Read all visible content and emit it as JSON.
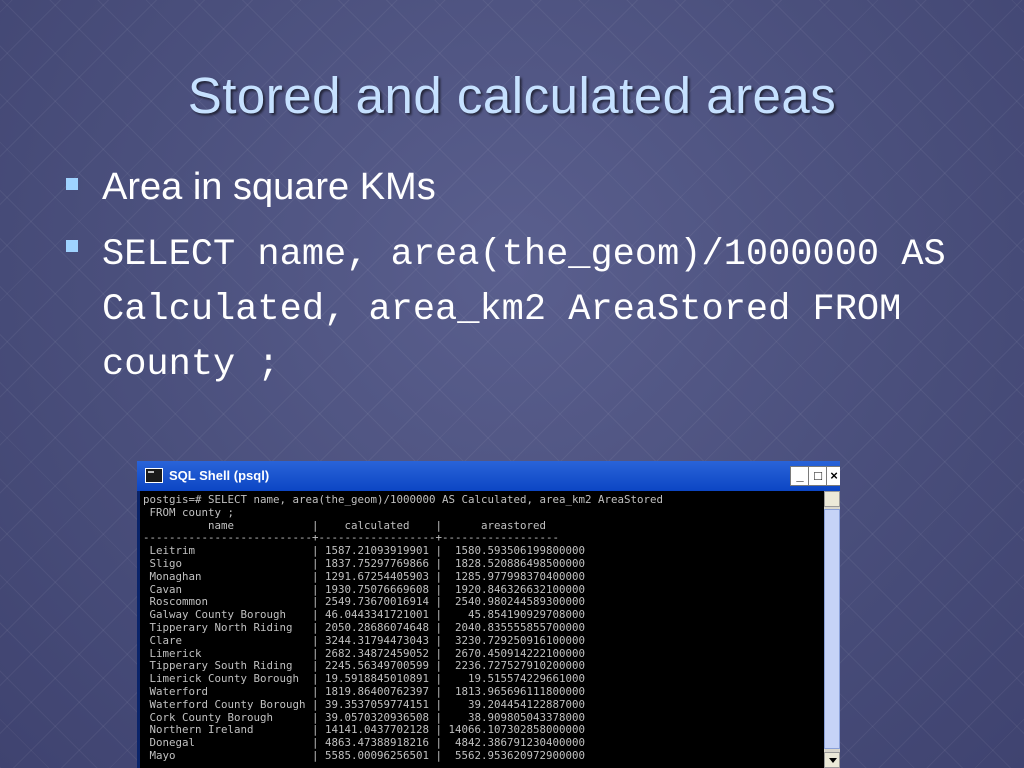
{
  "slide": {
    "title": "Stored and calculated areas",
    "bullets": [
      "Area in square KMs",
      "SELECT name, area(the_geom)/1000000 AS Calculated, area_km2 AreaStored FROM county ;"
    ]
  },
  "window": {
    "title": "SQL Shell (psql)",
    "min_label": "_",
    "max_label": "□",
    "close_label": "×",
    "console_lines": [
      "postgis=# SELECT name, area(the_geom)/1000000 AS Calculated, area_km2 AreaStored",
      " FROM county ;",
      "          name            |    calculated    |      areastored",
      "--------------------------+------------------+------------------",
      " Leitrim                  | 1587.21093919901 |  1580.593506199800000",
      " Sligo                    | 1837.75297769866 |  1828.520886498500000",
      " Monaghan                 | 1291.67254405903 |  1285.977998370400000",
      " Cavan                    | 1930.75076669608 |  1920.846326632100000",
      " Roscommon                | 2549.73670016914 |  2540.980244589300000",
      " Galway County Borough    | 46.0443341721001 |    45.854190929708000",
      " Tipperary North Riding   | 2050.28686074648 |  2040.835555855700000",
      " Clare                    | 3244.31794473043 |  3230.729250916100000",
      " Limerick                 | 2682.34872459052 |  2670.450914222100000",
      " Tipperary South Riding   | 2245.56349700599 |  2236.727527910200000",
      " Limerick County Borough  | 19.5918845010891 |    19.515574229661000",
      " Waterford                | 1819.86400762397 |  1813.965696111800000",
      " Waterford County Borough | 39.3537059774151 |    39.204454122887000",
      " Cork County Borough      | 39.0570320936508 |    38.909805043378000",
      " Northern Ireland         | 14141.0437702128 | 14066.107302858000000",
      " Donegal                  | 4863.47388918216 |  4842.386791230400000",
      " Mayo                     | 5585.00096256501 |  5562.953620972900000"
    ]
  },
  "colors": {
    "background": "#4a4f7c",
    "title": "#c6e1ff",
    "bullet": "#9fd3ff",
    "titlebar": "#0c46c4",
    "console_bg": "#000000",
    "console_text": "#c0c0c0"
  },
  "icons": {
    "bullet": "square-bullet-icon",
    "app": "terminal-icon"
  }
}
